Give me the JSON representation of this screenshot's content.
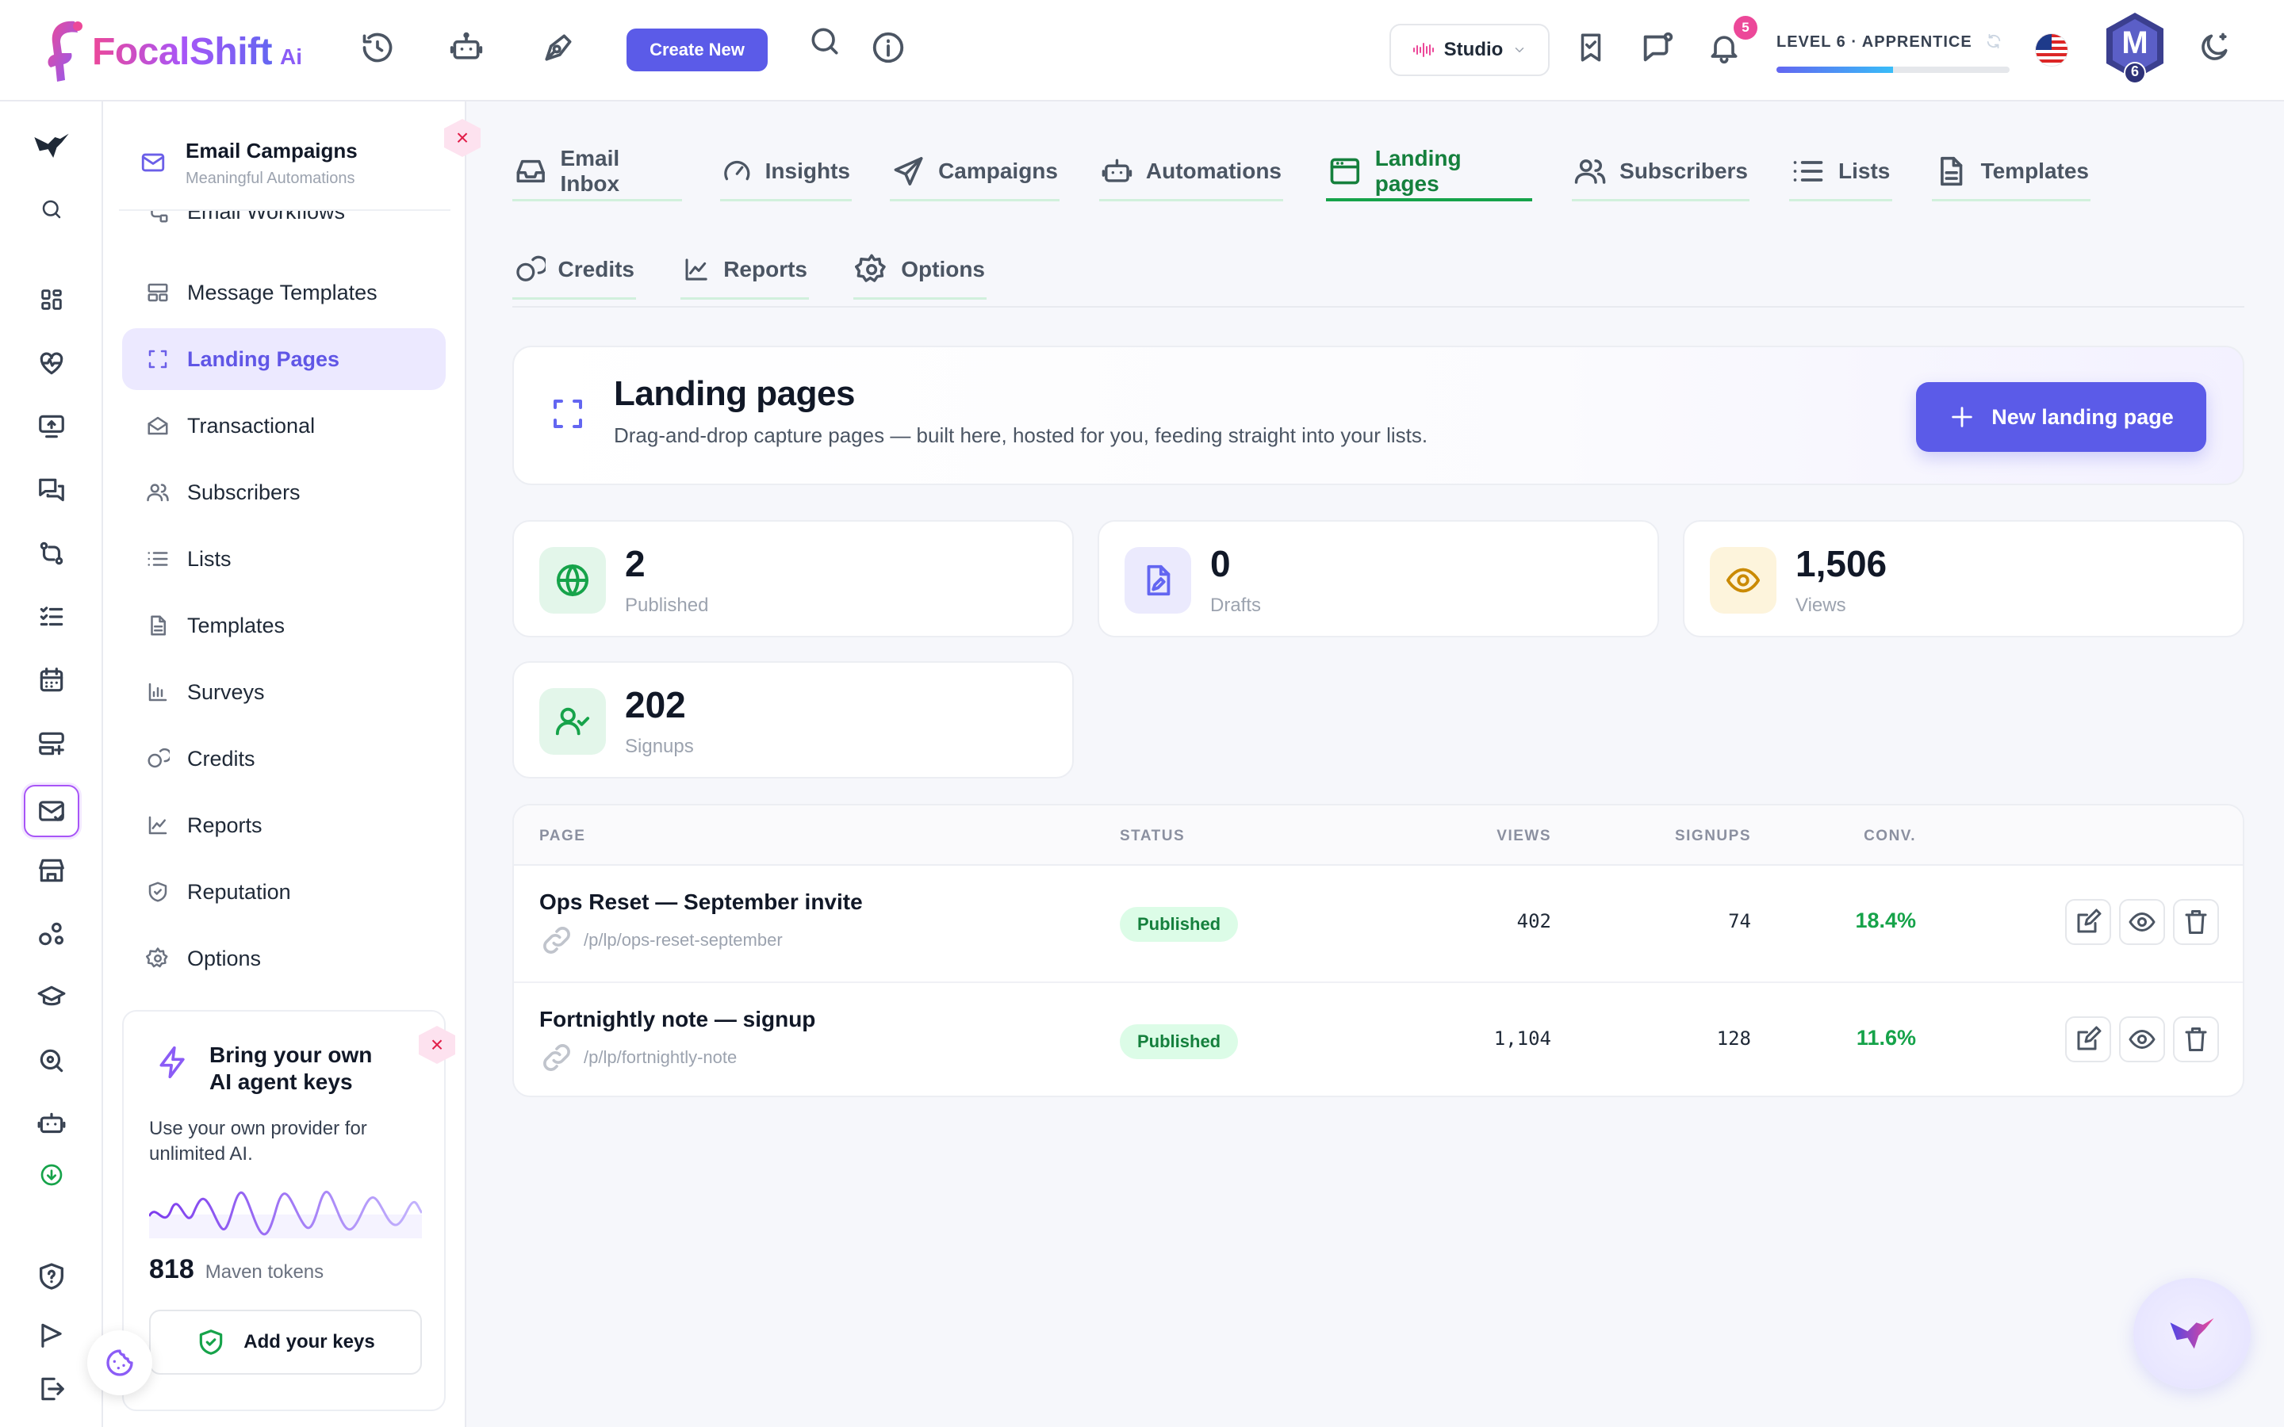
{
  "brand": {
    "name": "FocalShift",
    "suffix": "Ai"
  },
  "topbar": {
    "create_label": "Create New",
    "studio_label": "Studio",
    "notification_count": "5",
    "level_label": "LEVEL 6 · APPRENTICE",
    "level_progress_percent": 50,
    "avatar_letter": "M",
    "avatar_level": "6"
  },
  "sidebar": {
    "title": "Email Campaigns",
    "subtitle": "Meaningful Automations",
    "cut_item": "Email Workflows",
    "items": [
      {
        "label": "Message Templates",
        "icon": "layout-icon"
      },
      {
        "label": "Landing Pages",
        "icon": "focus-frame-icon",
        "active": true
      },
      {
        "label": "Transactional",
        "icon": "envelope-open-icon"
      },
      {
        "label": "Subscribers",
        "icon": "users-icon"
      },
      {
        "label": "Lists",
        "icon": "list-icon"
      },
      {
        "label": "Templates",
        "icon": "document-icon"
      },
      {
        "label": "Surveys",
        "icon": "bar-chart-icon"
      },
      {
        "label": "Credits",
        "icon": "coins-icon"
      },
      {
        "label": "Reports",
        "icon": "line-chart-icon"
      },
      {
        "label": "Reputation",
        "icon": "shield-icon"
      },
      {
        "label": "Options",
        "icon": "gear-icon"
      }
    ],
    "promo": {
      "title": "Bring your own AI agent keys",
      "text": "Use your own provider for unlimited AI.",
      "tokens_value": "818",
      "tokens_label": "Maven tokens",
      "button_label": "Add your keys"
    }
  },
  "tabs": {
    "primary": [
      {
        "label": "Email Inbox",
        "icon": "inbox-icon"
      },
      {
        "label": "Insights",
        "icon": "gauge-icon"
      },
      {
        "label": "Campaigns",
        "icon": "send-icon"
      },
      {
        "label": "Automations",
        "icon": "robot-icon"
      },
      {
        "label": "Landing pages",
        "icon": "browser-icon",
        "active": true
      },
      {
        "label": "Subscribers",
        "icon": "users-icon"
      },
      {
        "label": "Lists",
        "icon": "list-icon"
      },
      {
        "label": "Templates",
        "icon": "document-icon"
      }
    ],
    "secondary": [
      {
        "label": "Credits",
        "icon": "coins-icon"
      },
      {
        "label": "Reports",
        "icon": "line-chart-icon"
      },
      {
        "label": "Options",
        "icon": "gear-icon"
      }
    ]
  },
  "hero": {
    "title": "Landing pages",
    "subtitle": "Drag-and-drop capture pages — built here, hosted for you, feeding straight into your lists.",
    "button_label": "New landing page"
  },
  "stats": [
    {
      "value": "2",
      "label": "Published",
      "icon": "globe-icon",
      "color": "#16a34a",
      "bg": "#e3f6ea"
    },
    {
      "value": "0",
      "label": "Drafts",
      "icon": "file-pen-icon",
      "color": "#6366f1",
      "bg": "#ebeafd"
    },
    {
      "value": "1,506",
      "label": "Views",
      "icon": "eye-icon",
      "color": "#ca8a04",
      "bg": "#fdf4dc"
    },
    {
      "value": "202",
      "label": "Signups",
      "icon": "user-check-icon",
      "color": "#16a34a",
      "bg": "#e3f6ea"
    }
  ],
  "table": {
    "headers": {
      "page": "PAGE",
      "status": "STATUS",
      "views": "VIEWS",
      "signups": "SIGNUPS",
      "conv": "CONV."
    },
    "rows": [
      {
        "name": "Ops Reset — September invite",
        "url": "/p/lp/ops-reset-september",
        "status": "Published",
        "views": "402",
        "signups": "74",
        "conv": "18.4%"
      },
      {
        "name": "Fortnightly note — signup",
        "url": "/p/lp/fortnightly-note",
        "status": "Published",
        "views": "1,104",
        "signups": "128",
        "conv": "11.6%"
      }
    ]
  },
  "colors": {
    "accent": "#5b5be8",
    "success": "#16a34a",
    "brand_pink": "#ec4899"
  }
}
